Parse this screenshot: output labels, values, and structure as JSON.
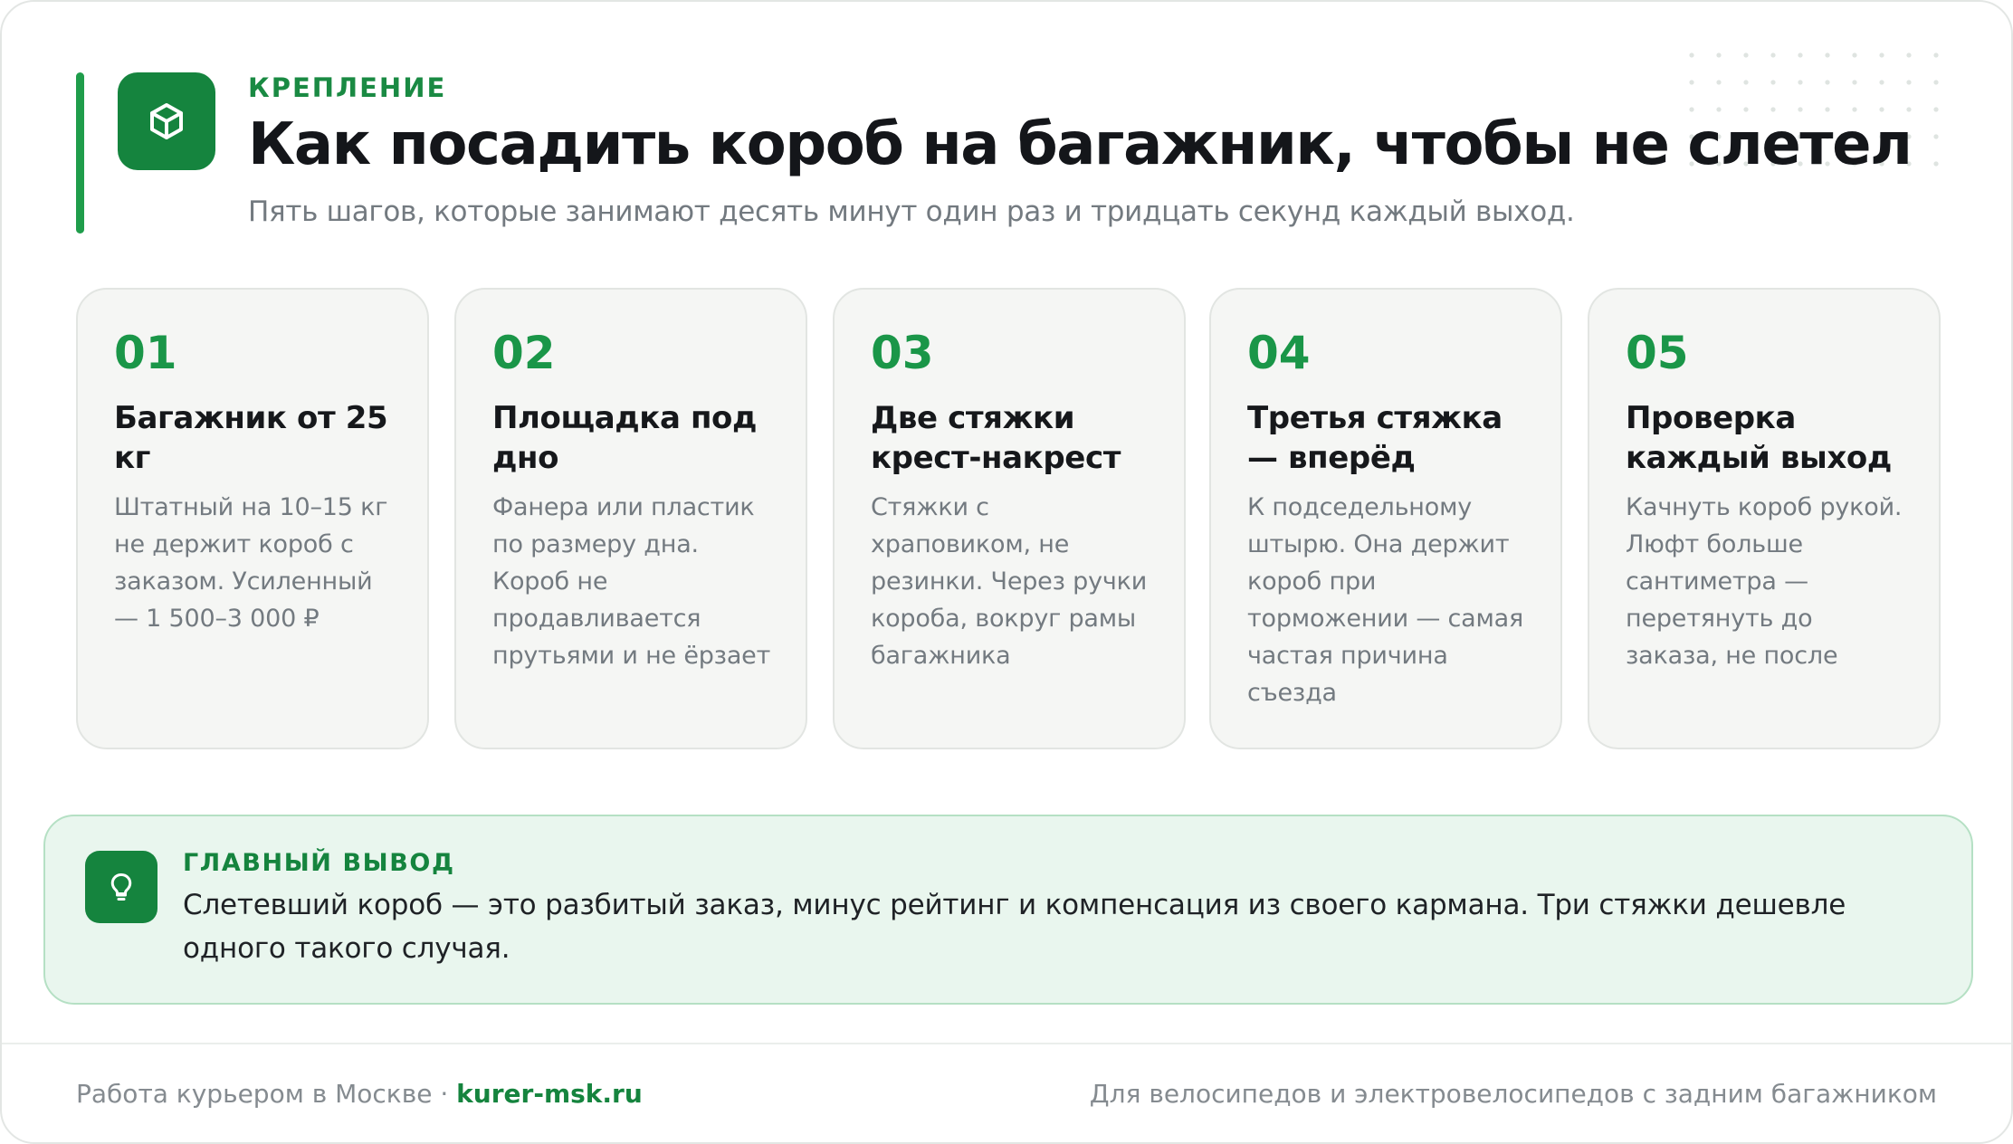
{
  "colors": {
    "accent": "#15843e",
    "accent_light": "#1f9d4b",
    "card_bg": "#f5f6f4",
    "takeaway_bg": "#e9f6ee"
  },
  "header": {
    "icon": "box-icon",
    "eyebrow": "КРЕПЛЕНИЕ",
    "title": "Как посадить короб на багажник, чтобы не слетел",
    "subtitle": "Пять шагов, которые занимают десять минут один раз и тридцать секунд каждый выход."
  },
  "steps": [
    {
      "number": "01",
      "title": "Багажник от 25 кг",
      "text": "Штатный на 10–15 кг не держит короб с заказом. Усиленный — 1 500–3 000 ₽"
    },
    {
      "number": "02",
      "title": "Площадка под дно",
      "text": "Фанера или пластик по размеру дна. Короб не продавливается прутьями и не ёрзает"
    },
    {
      "number": "03",
      "title": "Две стяжки крест-накрест",
      "text": "Стяжки с храповиком, не резинки. Через ручки короба, вокруг рамы багажника"
    },
    {
      "number": "04",
      "title": "Третья стяжка — вперёд",
      "text": "К подседельному штырю. Она держит короб при торможении — самая частая причина съезда"
    },
    {
      "number": "05",
      "title": "Проверка каждый выход",
      "text": "Качнуть короб рукой. Люфт больше сантиметра — перетянуть до заказа, не после"
    }
  ],
  "takeaway": {
    "icon": "lightbulb-icon",
    "label": "ГЛАВНЫЙ ВЫВОД",
    "text": "Слетевший короб — это разбитый заказ, минус рейтинг и компенсация из своего кармана. Три стяжки дешевле одного такого случая."
  },
  "footer": {
    "left_prefix": "Работа курьером в Москве · ",
    "site": "kurer-msk.ru",
    "right": "Для велосипедов и электровелосипедов с задним багажником"
  }
}
